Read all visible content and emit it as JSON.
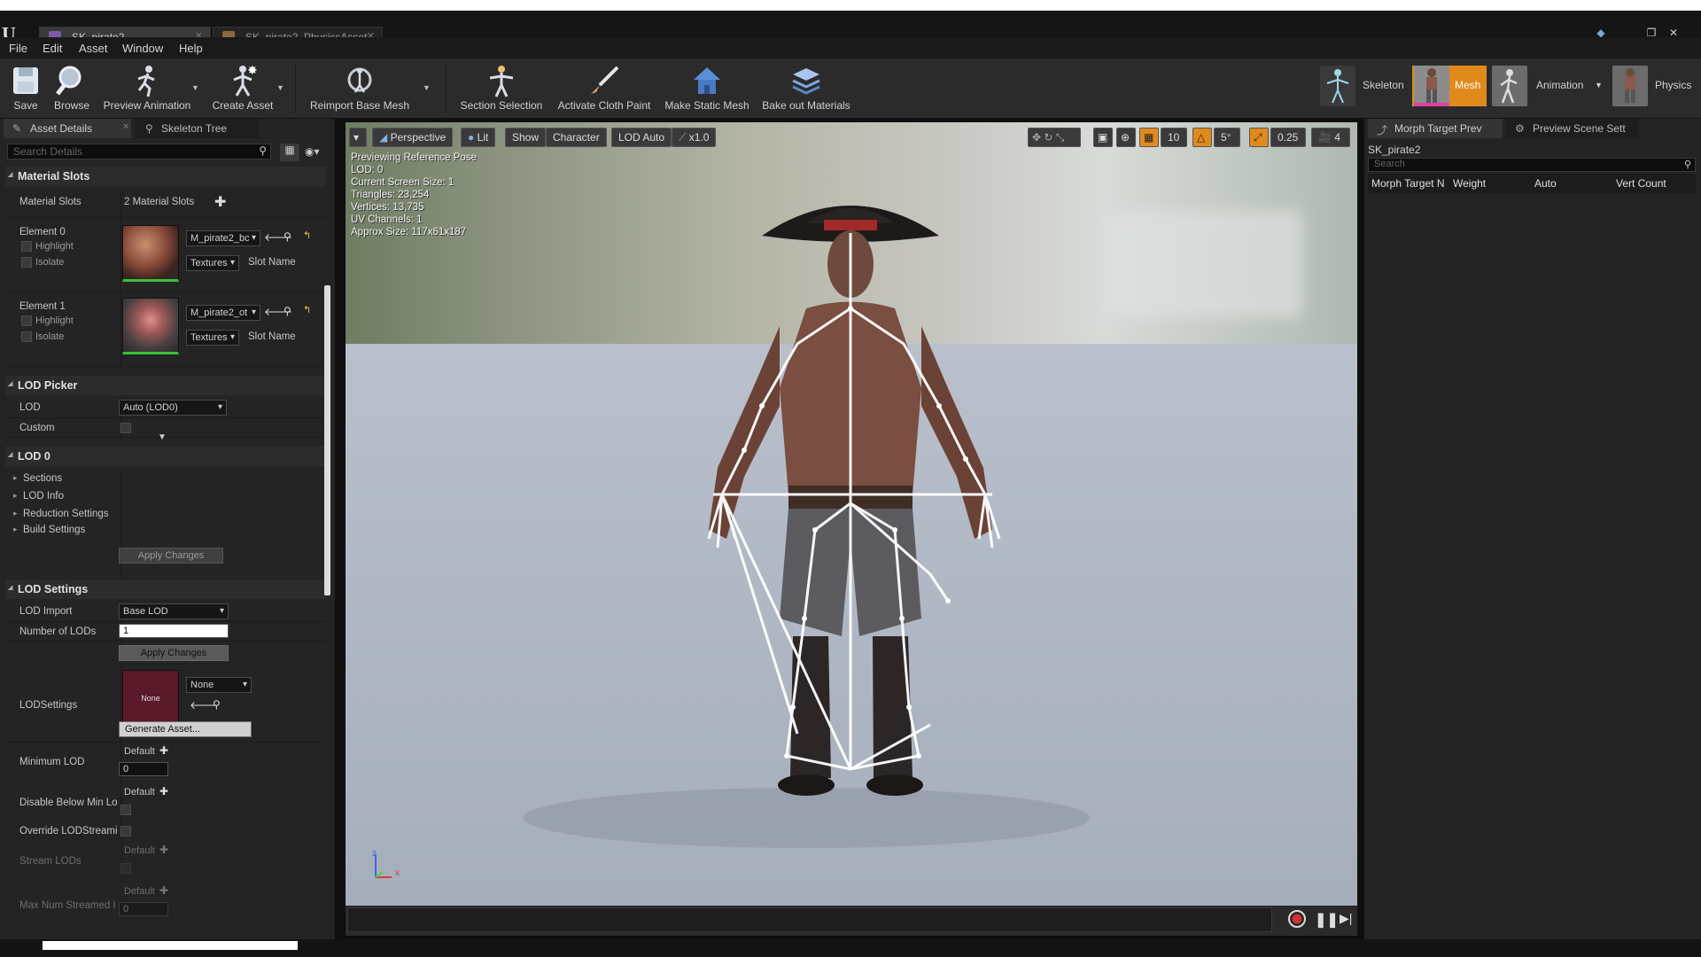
{
  "titlebar": {
    "tabs": [
      {
        "label": "SK_pirate2",
        "icon": "skeletal-mesh-icon"
      },
      {
        "label": "SK_pirate2_PhysicsAsset",
        "icon": "physics-asset-icon"
      }
    ]
  },
  "menu": [
    "File",
    "Edit",
    "Asset",
    "Window",
    "Help"
  ],
  "toolbar": {
    "save": "Save",
    "browse": "Browse",
    "preview_animation": "Preview Animation",
    "create_asset": "Create Asset",
    "reimport": "Reimport Base Mesh",
    "section_selection": "Section Selection",
    "cloth_paint": "Activate Cloth Paint",
    "make_static": "Make Static Mesh",
    "bake_materials": "Bake out Materials"
  },
  "modes": {
    "skeleton": "Skeleton",
    "mesh": "Mesh",
    "animation": "Animation",
    "physics": "Physics"
  },
  "left_panel": {
    "tabs": [
      "Asset Details",
      "Skeleton Tree"
    ],
    "search_placeholder": "Search Details",
    "material_slots": {
      "header": "Material Slots",
      "label": "Material Slots",
      "count": "2 Material Slots",
      "elements": [
        {
          "name": "Element 0",
          "highlight": "Highlight",
          "isolate": "Isolate",
          "material": "M_pirate2_bc",
          "textures": "Textures",
          "slot": "Slot Name"
        },
        {
          "name": "Element 1",
          "highlight": "Highlight",
          "isolate": "Isolate",
          "material": "M_pirate2_ot",
          "textures": "Textures",
          "slot": "Slot Name"
        }
      ]
    },
    "lod_picker": {
      "header": "LOD Picker",
      "lod_label": "LOD",
      "lod_value": "Auto (LOD0)",
      "custom_label": "Custom"
    },
    "lod0": {
      "header": "LOD 0",
      "items": [
        "Sections",
        "LOD Info",
        "Reduction Settings",
        "Build Settings"
      ],
      "apply": "Apply Changes"
    },
    "lod_settings": {
      "header": "LOD Settings",
      "lod_import_label": "LOD Import",
      "lod_import_value": "Base LOD",
      "num_lods_label": "Number of LODs",
      "num_lods_value": "1",
      "apply": "Apply Changes",
      "lodsettings_label": "LODSettings",
      "asset_thumb": "None",
      "asset_value": "None",
      "generate": "Generate Asset...",
      "min_lod_label": "Minimum LOD",
      "default": "Default",
      "min_lod_value": "0",
      "disable_below_label": "Disable Below Min Lo",
      "override_label": "Override LODStreami",
      "stream_lods_label": "Stream LODs",
      "max_streamed_label": "Max Num Streamed I",
      "max_streamed_value": "0"
    }
  },
  "viewport": {
    "buttons": {
      "perspective": "Perspective",
      "lit": "Lit",
      "show": "Show",
      "character": "Character",
      "lod": "LOD Auto",
      "speed": "x1.0"
    },
    "right_controls": {
      "grid": "10",
      "angle": "5°",
      "scale": "0.25",
      "camera_speed": "4"
    },
    "info": [
      "Previewing Reference Pose",
      "LOD: 0",
      "Current Screen Size: 1",
      "Triangles: 23,254",
      "Vertices: 13,735",
      "UV Channels: 1",
      "Approx Size: 117x61x187"
    ],
    "axis": {
      "x": "x",
      "z": "z"
    }
  },
  "right_panel": {
    "tabs": [
      "Morph Target Prev",
      "Preview Scene Sett"
    ],
    "asset": "SK_pirate2",
    "search_placeholder": "Search",
    "columns": [
      "Morph Target N",
      "Weight",
      "Auto",
      "Vert Count"
    ]
  },
  "colors": {
    "accent": "#e08a1c",
    "panel": "#242424",
    "toolbar": "#2b2b2b"
  }
}
